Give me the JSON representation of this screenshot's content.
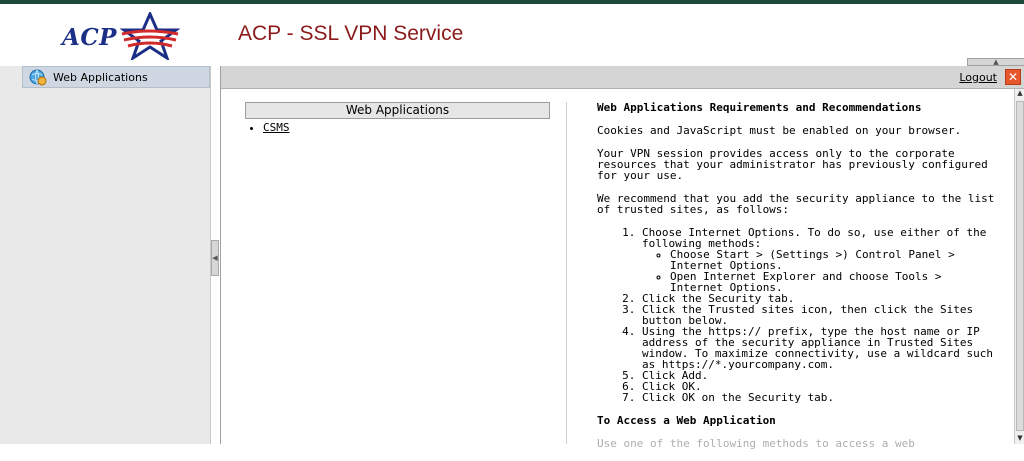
{
  "header": {
    "logo_text": "ACP",
    "title": "ACP - SSL VPN Service"
  },
  "sidebar": {
    "items": [
      {
        "label": "Web Applications",
        "icon": "globe-apps-icon"
      }
    ]
  },
  "toolbar": {
    "logout_label": "Logout",
    "close_glyph": "✕"
  },
  "left": {
    "header": "Web Applications",
    "apps": [
      {
        "label": "CSMS"
      }
    ]
  },
  "right": {
    "title": "Web Applications Requirements and Recommendations",
    "p1": "Cookies and JavaScript must be enabled on your browser.",
    "p2": "Your VPN session provides access only to the corporate resources that your administrator has previously configured for your use.",
    "p3": "We recommend that you add the security appliance to the list of trusted sites, as follows:",
    "steps": [
      "Choose Internet Options. To do so, use either of the following methods:",
      "Click the Security tab.",
      "Click the Trusted sites icon, then click the Sites button below.",
      "Using the https:// prefix, type the host name or IP address of the security appliance in Trusted Sites window. To maximize connectivity, use a wildcard such as https://*.yourcompany.com.",
      "Click Add.",
      "Click OK.",
      "Click OK on the Security tab."
    ],
    "sub_steps": [
      "Choose Start > (Settings >) Control Panel > Internet Options.",
      "Open Internet Explorer and choose Tools > Internet Options."
    ],
    "title2": "To Access a Web Application",
    "p4": "Use one of the following methods to access a web"
  },
  "colors": {
    "title": "#8b1a1a",
    "logo_blue": "#1b2f86",
    "logo_red": "#d12a2a",
    "topbar": "#1f4a3a",
    "close": "#e8562b"
  }
}
